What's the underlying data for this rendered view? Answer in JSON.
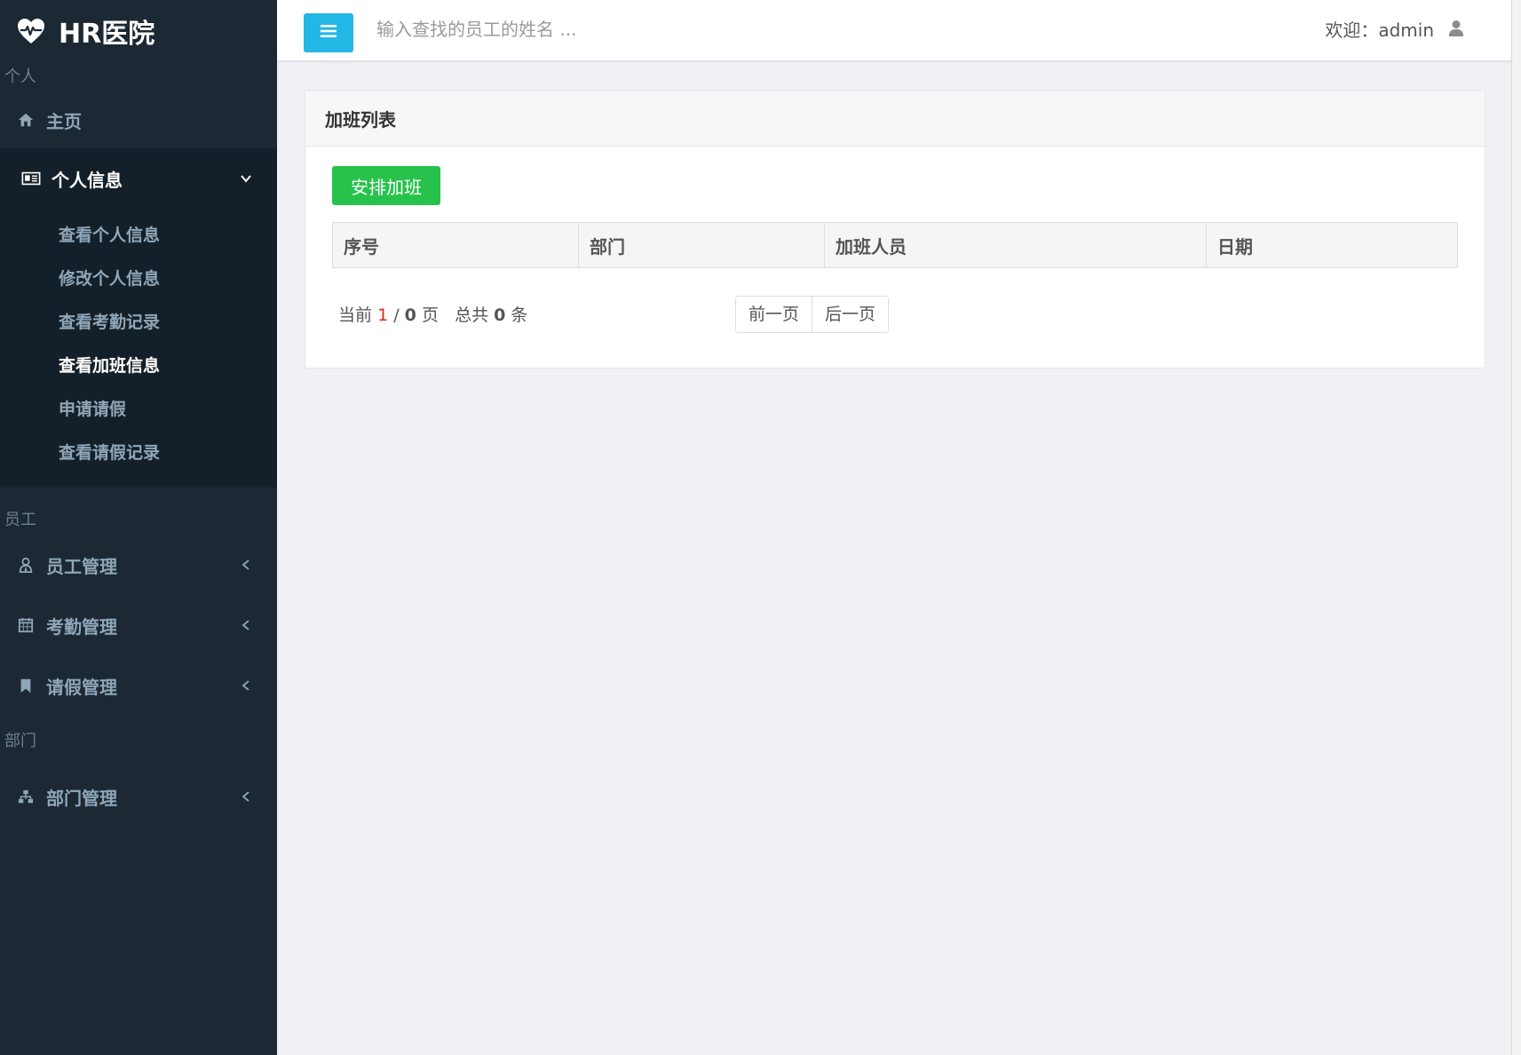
{
  "brand": {
    "name": "HR医院",
    "icon": "heartbeat-icon"
  },
  "sidebar": {
    "sections": [
      {
        "label": "个人"
      },
      {
        "label": "员工"
      },
      {
        "label": "部门"
      }
    ],
    "home": {
      "label": "主页",
      "icon": "home-icon"
    },
    "personal": {
      "label": "个人信息",
      "icon": "id-card-icon",
      "items": [
        {
          "label": "查看个人信息"
        },
        {
          "label": "修改个人信息"
        },
        {
          "label": "查看考勤记录"
        },
        {
          "label": "查看加班信息"
        },
        {
          "label": "申请请假"
        },
        {
          "label": "查看请假记录"
        }
      ]
    },
    "employee_mgmt": {
      "label": "员工管理",
      "icon": "user-tie-icon"
    },
    "attendance_mgmt": {
      "label": "考勤管理",
      "icon": "calendar-icon"
    },
    "leave_mgmt": {
      "label": "请假管理",
      "icon": "bookmark-icon"
    },
    "dept_mgmt": {
      "label": "部门管理",
      "icon": "sitemap-icon"
    }
  },
  "topbar": {
    "search_placeholder": "输入查找的员工的姓名 ...",
    "welcome": "欢迎：admin",
    "accent": "#23b7e5"
  },
  "panel": {
    "title": "加班列表",
    "add_button": "安排加班",
    "columns": [
      "序号",
      "部门",
      "加班人员",
      "日期"
    ],
    "pager": {
      "prefix": "当前",
      "current": "1",
      "sep": "/",
      "total_pages": "0",
      "page_unit": "页",
      "total_prefix": "总共",
      "total_records": "0",
      "record_unit": "条",
      "prev": "前一页",
      "next": "后一页"
    }
  },
  "colors": {
    "sidebar_bg": "#1c2833",
    "add_button": "#27c24c",
    "current_page": "#e8231f"
  }
}
